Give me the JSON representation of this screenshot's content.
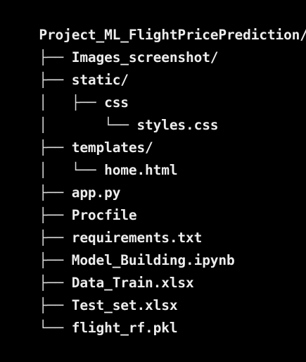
{
  "colors": {
    "background": "#000000",
    "text": "#ececec"
  },
  "tree": {
    "root": "Project_ML_FlightPricePrediction/",
    "lines": [
      {
        "prefix": "├── ",
        "name": "Images_screenshot/"
      },
      {
        "prefix": "├── ",
        "name": "static/"
      },
      {
        "prefix": "│   ├── ",
        "name": "css"
      },
      {
        "prefix": "│       └── ",
        "name": "styles.css"
      },
      {
        "prefix": "├── ",
        "name": "templates/"
      },
      {
        "prefix": "│   └── ",
        "name": "home.html"
      },
      {
        "prefix": "├── ",
        "name": "app.py"
      },
      {
        "prefix": "├── ",
        "name": "Procfile"
      },
      {
        "prefix": "├── ",
        "name": "requirements.txt"
      },
      {
        "prefix": "├── ",
        "name": "Model_Building.ipynb"
      },
      {
        "prefix": "├── ",
        "name": "Data_Train.xlsx"
      },
      {
        "prefix": "├── ",
        "name": "Test_set.xlsx"
      },
      {
        "prefix": "└── ",
        "name": "flight_rf.pkl"
      }
    ]
  }
}
